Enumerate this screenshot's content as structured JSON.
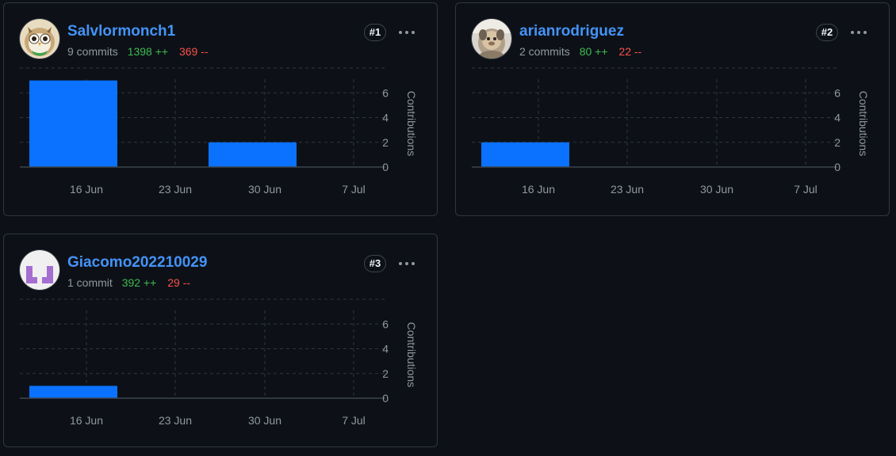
{
  "axis_label": "Contributions",
  "x_ticks": [
    "16 Jun",
    "23 Jun",
    "30 Jun",
    "7 Jul"
  ],
  "y_ticks": [
    "0",
    "2",
    "4",
    "6"
  ],
  "contributors": [
    {
      "username": "Salvlormonch1",
      "commits": "9 commits",
      "additions": "1398 ++",
      "deletions": "369 --",
      "rank": "#1",
      "avatar_icon": "owl-avatar-icon"
    },
    {
      "username": "arianrodriguez",
      "commits": "2 commits",
      "additions": "80 ++",
      "deletions": "22 --",
      "rank": "#2",
      "avatar_icon": "monkey-photo-avatar-icon"
    },
    {
      "username": "Giacomo202210029",
      "commits": "1 commit",
      "additions": "392 ++",
      "deletions": "29 --",
      "rank": "#3",
      "avatar_icon": "identicon-avatar-icon"
    }
  ],
  "colors": {
    "bar": "#0a72ff",
    "link": "#4493f8",
    "additions": "#3fb950",
    "deletions": "#f85149",
    "grid": "#30363d"
  },
  "chart_data": [
    {
      "type": "bar",
      "categories": [
        "16 Jun",
        "23 Jun",
        "30 Jun",
        "7 Jul"
      ],
      "values": [
        7,
        0,
        2,
        0
      ],
      "ylabel": "Contributions",
      "ylim": [
        0,
        8
      ],
      "grid": true
    },
    {
      "type": "bar",
      "categories": [
        "16 Jun",
        "23 Jun",
        "30 Jun",
        "7 Jul"
      ],
      "values": [
        2,
        0,
        0,
        0
      ],
      "ylabel": "Contributions",
      "ylim": [
        0,
        8
      ],
      "grid": true
    },
    {
      "type": "bar",
      "categories": [
        "16 Jun",
        "23 Jun",
        "30 Jun",
        "7 Jul"
      ],
      "values": [
        1,
        0,
        0,
        0
      ],
      "ylabel": "Contributions",
      "ylim": [
        0,
        8
      ],
      "grid": true
    }
  ]
}
